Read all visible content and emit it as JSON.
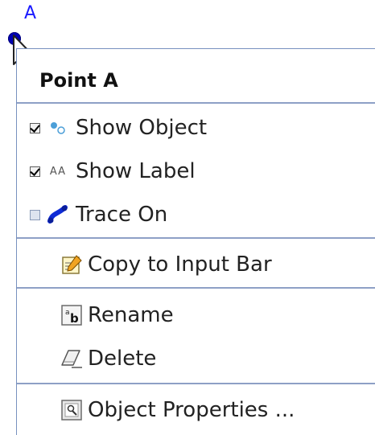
{
  "canvas": {
    "point_name": "A"
  },
  "menu": {
    "title": "Point A",
    "items": [
      {
        "label": "Show Object",
        "checkbox": true,
        "checked": true,
        "icon": "show-object-icon"
      },
      {
        "label": "Show Label",
        "checkbox": true,
        "checked": true,
        "icon": "show-label-icon"
      },
      {
        "label": "Trace On",
        "checkbox": true,
        "checked": false,
        "icon": "trace-icon"
      },
      {
        "label": "Copy to Input Bar",
        "checkbox": false,
        "icon": "copy-to-input-bar-icon"
      },
      {
        "label": "Rename",
        "checkbox": false,
        "icon": "rename-icon"
      },
      {
        "label": "Delete",
        "checkbox": false,
        "icon": "delete-icon"
      },
      {
        "label": "Object Properties ...",
        "checkbox": false,
        "icon": "object-properties-icon"
      }
    ],
    "label_icon_text": "AA"
  }
}
